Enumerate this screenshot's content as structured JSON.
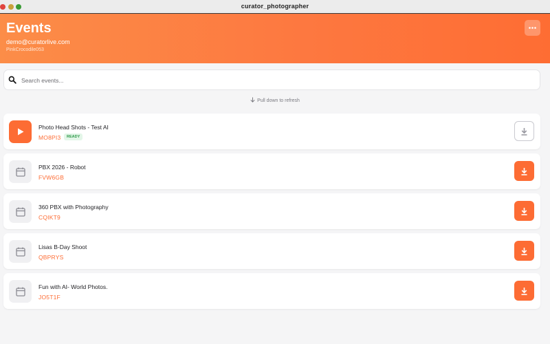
{
  "window": {
    "title": "curator_photographer"
  },
  "header": {
    "title": "Events",
    "email": "demo@curatorlive.com",
    "username": "PinkCrocodile053"
  },
  "search": {
    "placeholder": "Search events..."
  },
  "refresh_hint": "Pull down to refresh",
  "events": [
    {
      "name": "Photo Head Shots - Test AI",
      "code": "MO8PI3",
      "badge": "READY",
      "icon": "play-icon",
      "download_style": "outline"
    },
    {
      "name": "PBX 2026 - Robot",
      "code": "FVW6GB",
      "icon": "calendar-icon",
      "download_style": "filled"
    },
    {
      "name": "360 PBX with Photography",
      "code": "CQIKT9",
      "icon": "calendar-icon",
      "download_style": "filled"
    },
    {
      "name": "Lisas B-Day Shoot",
      "code": "QBPRYS",
      "icon": "calendar-icon",
      "download_style": "filled"
    },
    {
      "name": "Fun with AI- World Photos.",
      "code": "JO5T1F",
      "icon": "calendar-icon",
      "download_style": "filled"
    }
  ],
  "colors": {
    "accent": "#fd6c34",
    "header_gradient_start": "#fc8d48",
    "header_gradient_end": "#fe6d33",
    "ready_badge": "#2f9a4a"
  }
}
